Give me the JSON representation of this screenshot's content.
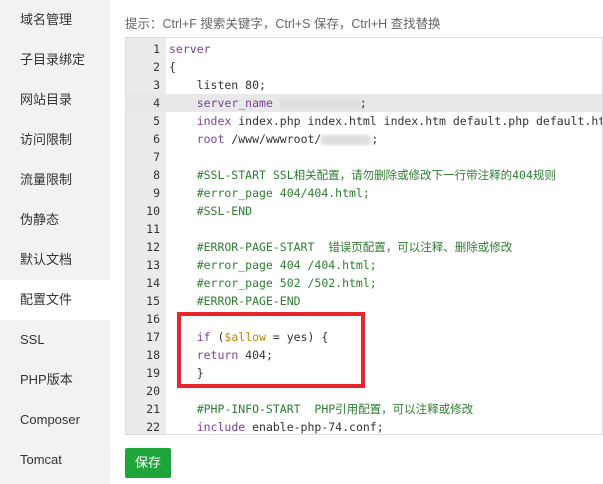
{
  "sidebar": {
    "items": [
      {
        "label": "域名管理"
      },
      {
        "label": "子目录绑定"
      },
      {
        "label": "网站目录"
      },
      {
        "label": "访问限制"
      },
      {
        "label": "流量限制"
      },
      {
        "label": "伪静态"
      },
      {
        "label": "默认文档"
      },
      {
        "label": "配置文件",
        "active": true
      },
      {
        "label": "SSL"
      },
      {
        "label": "PHP版本"
      },
      {
        "label": "Composer"
      },
      {
        "label": "Tomcat"
      }
    ]
  },
  "hint": "提示：Ctrl+F 搜索关键字，Ctrl+S 保存，Ctrl+H 查找替换",
  "editor": {
    "current_line": 4,
    "lines": [
      {
        "n": "1",
        "text": "server"
      },
      {
        "n": "2",
        "text": "{"
      },
      {
        "n": "3",
        "text": "    listen 80;"
      },
      {
        "n": "4",
        "text": "    server_name "
      },
      {
        "n": "5",
        "text": "    index index.php index.html index.htm default.php default.htm d"
      },
      {
        "n": "6",
        "text": "    root /www/wwwroot/"
      },
      {
        "n": "7",
        "text": ""
      },
      {
        "n": "8",
        "text": "    #SSL-START SSL相关配置，请勿删除或修改下一行带注释的404规则"
      },
      {
        "n": "9",
        "text": "    #error_page 404/404.html;"
      },
      {
        "n": "10",
        "text": "    #SSL-END"
      },
      {
        "n": "11",
        "text": ""
      },
      {
        "n": "12",
        "text": "    #ERROR-PAGE-START  错误页配置，可以注释、删除或修改"
      },
      {
        "n": "13",
        "text": "    #error_page 404 /404.html;"
      },
      {
        "n": "14",
        "text": "    #error_page 502 /502.html;"
      },
      {
        "n": "15",
        "text": "    #ERROR-PAGE-END"
      },
      {
        "n": "16",
        "text": ""
      },
      {
        "n": "17",
        "text": "    if ($allow = yes) {"
      },
      {
        "n": "18",
        "text": "    return 404;"
      },
      {
        "n": "19",
        "text": "    }"
      },
      {
        "n": "20",
        "text": ""
      },
      {
        "n": "21",
        "text": "    #PHP-INFO-START  PHP引用配置，可以注释或修改"
      },
      {
        "n": "22",
        "text": "    include enable-php-74.conf;"
      }
    ]
  },
  "save_label": "保存",
  "colors": {
    "accent": "#20a53a",
    "highlight": "#e5262b",
    "keyword": "#7a3ea0",
    "comment": "#2e7d32"
  }
}
